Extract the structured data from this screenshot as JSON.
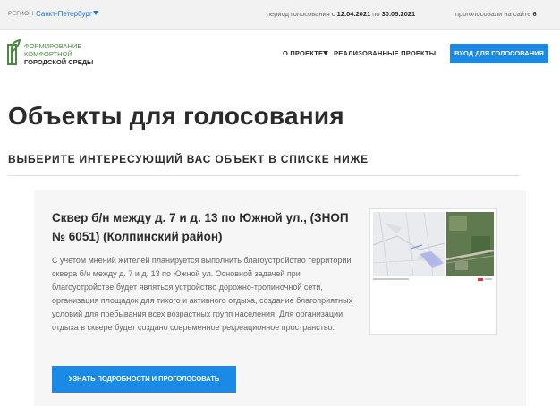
{
  "topbar": {
    "region_label": "Регион",
    "region_value": "Санкт-Петербург",
    "period_label": "период голосования с ",
    "period_from": "12.04.2021",
    "period_mid": " по ",
    "period_to": "30.05.2021",
    "voted_label": "проголосовали на сайте ",
    "voted_count": "6"
  },
  "logo": {
    "line1": "Формирование",
    "line2": "комфортной",
    "line3": "городской среды",
    "color": "#4a8c3f"
  },
  "nav": {
    "about": "О проекте",
    "projects": "Реализованные проекты",
    "login": "Вход для голосования"
  },
  "page": {
    "title": "Объекты для голосования",
    "subtitle": "Выберите интересующий вас объект в списке ниже"
  },
  "object": {
    "title": "Сквер б/н между д. 7 и д. 13 по Южной ул., (ЗНОП № 6051) (Колпинский район)",
    "description": "С учетом мнений жителей планируется выполнить благоустройство территории сквера б/н между д. 7 и д. 13 по Южной ул. Основной задачей при благоустройстве будет являться устройство дорожно-тропиночной сети, организация площадок для тихого и активного отдыха, создание благоприятных условий для пребывания всех возрастных групп населения. Для организации отдыха в сквере будет создано современное рекреационное пространство.",
    "button": "Узнать подробности и проголосовать",
    "image": "map-thumbnail"
  },
  "colors": {
    "accent": "#1a8ae6",
    "link": "#1a73e8",
    "text": "#2b2b2b"
  }
}
